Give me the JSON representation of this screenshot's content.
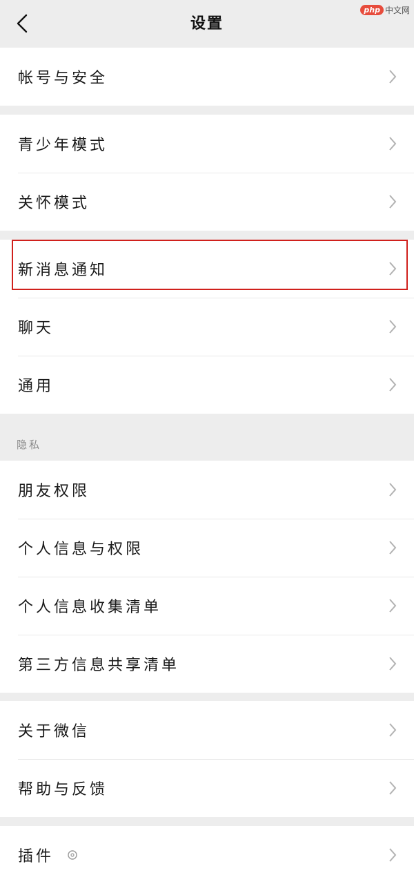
{
  "header": {
    "title": "设置",
    "watermark": "中文网",
    "watermark_logo": "php"
  },
  "groups": [
    {
      "items": [
        {
          "label": "帐号与安全"
        }
      ]
    },
    {
      "items": [
        {
          "label": "青少年模式"
        },
        {
          "label": "关怀模式"
        }
      ]
    },
    {
      "items": [
        {
          "label": "新消息通知"
        },
        {
          "label": "聊天"
        },
        {
          "label": "通用"
        }
      ]
    },
    {
      "section_label": "隐私",
      "items": [
        {
          "label": "朋友权限"
        },
        {
          "label": "个人信息与权限"
        },
        {
          "label": "个人信息收集清单"
        },
        {
          "label": "第三方信息共享清单"
        }
      ]
    },
    {
      "items": [
        {
          "label": "关于微信"
        },
        {
          "label": "帮助与反馈"
        }
      ]
    },
    {
      "items": [
        {
          "label": "插件"
        }
      ]
    }
  ],
  "colors": {
    "background": "#ededed",
    "card": "#ffffff",
    "highlight_border": "#d0201c",
    "chevron": "#b2b2b2"
  },
  "icons": [
    "back-arrow-icon",
    "chevron-right-icon",
    "plugin-gear-icon"
  ]
}
